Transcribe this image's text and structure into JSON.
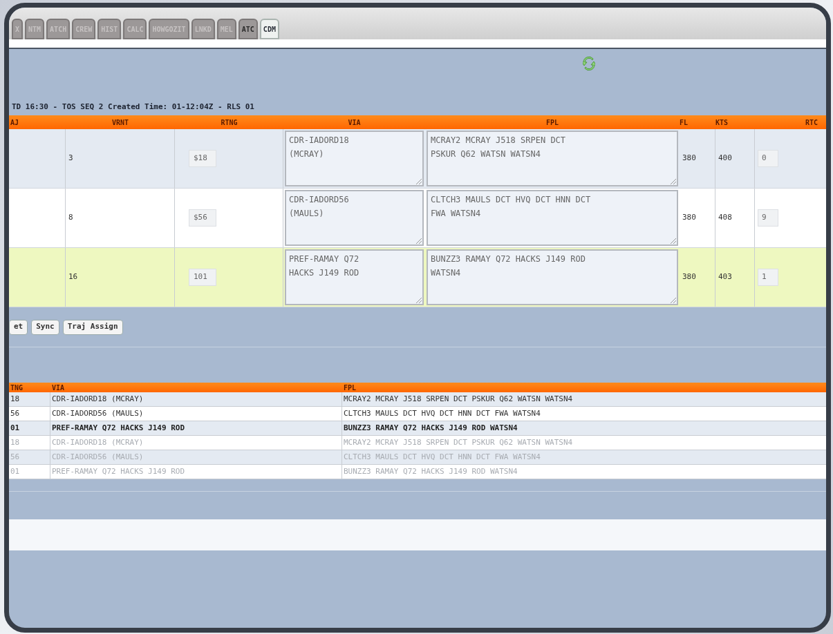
{
  "tabs": [
    {
      "label": "X",
      "selected": false,
      "disabled": true
    },
    {
      "label": "NTM",
      "selected": false,
      "disabled": true
    },
    {
      "label": "ATCH",
      "selected": false,
      "disabled": true
    },
    {
      "label": "CREW",
      "selected": false,
      "disabled": true
    },
    {
      "label": "HIST",
      "selected": false,
      "disabled": true
    },
    {
      "label": "CALC",
      "selected": false,
      "disabled": true
    },
    {
      "label": "HOWGOZIT",
      "selected": false,
      "disabled": true
    },
    {
      "label": "LNKD",
      "selected": false,
      "disabled": true
    },
    {
      "label": "MEL",
      "selected": false,
      "disabled": true
    },
    {
      "label": "ATC",
      "selected": false,
      "disabled": false
    },
    {
      "label": "CDM",
      "selected": true,
      "disabled": false
    }
  ],
  "info_line": "TD 16:30 - TOS SEQ 2 Created Time: 01-12:04Z - RLS 01",
  "routes_table": {
    "columns": [
      "AJ",
      "VRNT",
      "RTNG",
      "VIA",
      "FPL",
      "FL",
      "KTS",
      "RTC"
    ],
    "rows": [
      {
        "vrnt": "3",
        "rtng": "$18",
        "via": "CDR-IADORD18 (MCRAY)",
        "fpl": "MCRAY2 MCRAY J518 SRPEN DCT PSKUR Q62 WATSN WATSN4",
        "fl": "380",
        "kts": "400",
        "rtc": "0",
        "selected": false
      },
      {
        "vrnt": "8",
        "rtng": "$56",
        "via": "CDR-IADORD56 (MAULS)",
        "fpl": "CLTCH3 MAULS DCT HVQ DCT HNN DCT FWA WATSN4",
        "fl": "380",
        "kts": "408",
        "rtc": "9",
        "selected": false
      },
      {
        "vrnt": "16",
        "rtng": "101",
        "via": "PREF-RAMAY Q72 HACKS J149 ROD",
        "fpl": "BUNZZ3 RAMAY Q72 HACKS J149 ROD WATSN4",
        "fl": "380",
        "kts": "403",
        "rtc": "1",
        "selected": true
      }
    ]
  },
  "buttons": [
    "et",
    "Sync",
    "Traj Assign"
  ],
  "history_table": {
    "columns": [
      "TNG",
      "VIA",
      "FPL"
    ],
    "rows": [
      {
        "rtng": "18",
        "via": "CDR-IADORD18 (MCRAY)",
        "fpl": "MCRAY2 MCRAY J518 SRPEN DCT PSKUR Q62 WATSN WATSN4",
        "dimmed": false
      },
      {
        "rtng": "56",
        "via": "CDR-IADORD56 (MAULS)",
        "fpl": "CLTCH3 MAULS DCT HVQ DCT HNN DCT FWA WATSN4",
        "dimmed": false
      },
      {
        "rtng": "01",
        "via": "PREF-RAMAY Q72 HACKS J149 ROD",
        "fpl": "BUNZZ3 RAMAY Q72 HACKS J149 ROD WATSN4",
        "dimmed": false
      },
      {
        "rtng": "18",
        "via": "CDR-IADORD18 (MCRAY)",
        "fpl": "MCRAY2 MCRAY J518 SRPEN DCT PSKUR Q62 WATSN WATSN4",
        "dimmed": true
      },
      {
        "rtng": "56",
        "via": "CDR-IADORD56 (MAULS)",
        "fpl": "CLTCH3 MAULS DCT HVQ DCT HNN DCT FWA WATSN4",
        "dimmed": true
      },
      {
        "rtng": "01",
        "via": "PREF-RAMAY Q72 HACKS J149 ROD",
        "fpl": "BUNZZ3 RAMAY Q72 HACKS J149 ROD WATSN4",
        "dimmed": true
      }
    ]
  }
}
